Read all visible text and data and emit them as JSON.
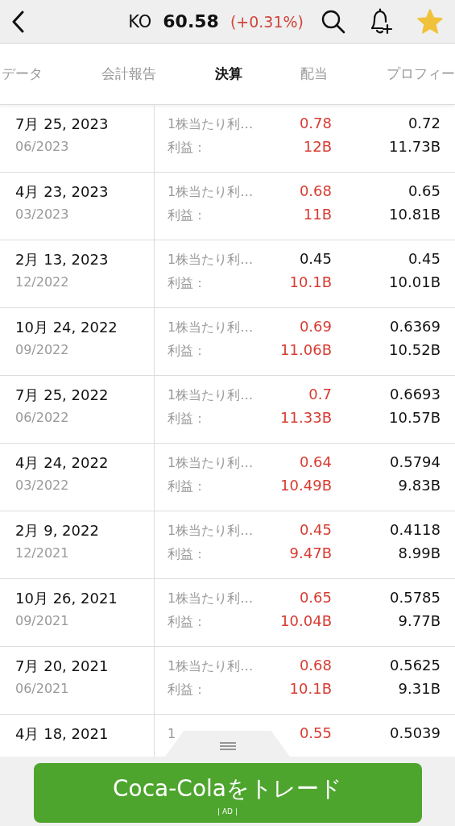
{
  "header": {
    "symbol": "KO",
    "price": "60.58",
    "change": "(+0.31%)",
    "favorite": true
  },
  "tabs": [
    {
      "label": "データ",
      "selected": false
    },
    {
      "label": "会計報告",
      "selected": false
    },
    {
      "label": "決算",
      "selected": true
    },
    {
      "label": "配当",
      "selected": false
    },
    {
      "label": "プロフィー",
      "selected": false
    }
  ],
  "rows": [
    {
      "date": "7月 25, 2023",
      "period": "06/2023",
      "eps_label": "1株当たり利…",
      "eps": "0.78",
      "eps_beat": true,
      "eps_forecast": "0.72",
      "revenue_label": "利益：",
      "revenue": "12B",
      "revenue_beat": true,
      "revenue_forecast": "11.73B"
    },
    {
      "date": "4月 23, 2023",
      "period": "03/2023",
      "eps_label": "1株当たり利…",
      "eps": "0.68",
      "eps_beat": true,
      "eps_forecast": "0.65",
      "revenue_label": "利益：",
      "revenue": "11B",
      "revenue_beat": true,
      "revenue_forecast": "10.81B"
    },
    {
      "date": "2月 13, 2023",
      "period": "12/2022",
      "eps_label": "1株当たり利…",
      "eps": "0.45",
      "eps_beat": false,
      "eps_forecast": "0.45",
      "revenue_label": "利益：",
      "revenue": "10.1B",
      "revenue_beat": true,
      "revenue_forecast": "10.01B"
    },
    {
      "date": "10月 24, 2022",
      "period": "09/2022",
      "eps_label": "1株当たり利…",
      "eps": "0.69",
      "eps_beat": true,
      "eps_forecast": "0.6369",
      "revenue_label": "利益：",
      "revenue": "11.06B",
      "revenue_beat": true,
      "revenue_forecast": "10.52B"
    },
    {
      "date": "7月 25, 2022",
      "period": "06/2022",
      "eps_label": "1株当たり利…",
      "eps": "0.7",
      "eps_beat": true,
      "eps_forecast": "0.6693",
      "revenue_label": "利益：",
      "revenue": "11.33B",
      "revenue_beat": true,
      "revenue_forecast": "10.57B"
    },
    {
      "date": "4月 24, 2022",
      "period": "03/2022",
      "eps_label": "1株当たり利…",
      "eps": "0.64",
      "eps_beat": true,
      "eps_forecast": "0.5794",
      "revenue_label": "利益：",
      "revenue": "10.49B",
      "revenue_beat": true,
      "revenue_forecast": "9.83B"
    },
    {
      "date": "2月 9, 2022",
      "period": "12/2021",
      "eps_label": "1株当たり利…",
      "eps": "0.45",
      "eps_beat": true,
      "eps_forecast": "0.4118",
      "revenue_label": "利益：",
      "revenue": "9.47B",
      "revenue_beat": true,
      "revenue_forecast": "8.99B"
    },
    {
      "date": "10月 26, 2021",
      "period": "09/2021",
      "eps_label": "1株当たり利…",
      "eps": "0.65",
      "eps_beat": true,
      "eps_forecast": "0.5785",
      "revenue_label": "利益：",
      "revenue": "10.04B",
      "revenue_beat": true,
      "revenue_forecast": "9.77B"
    },
    {
      "date": "7月 20, 2021",
      "period": "06/2021",
      "eps_label": "1株当たり利…",
      "eps": "0.68",
      "eps_beat": true,
      "eps_forecast": "0.5625",
      "revenue_label": "利益：",
      "revenue": "10.1B",
      "revenue_beat": true,
      "revenue_forecast": "9.31B"
    },
    {
      "date": "4月 18, 2021",
      "eps_label": "1",
      "eps": "0.55",
      "eps_beat": true,
      "eps_forecast": "0.5039"
    }
  ],
  "footer": {
    "button": "Coca-Colaをトレード",
    "ad_label": "| AD |"
  }
}
